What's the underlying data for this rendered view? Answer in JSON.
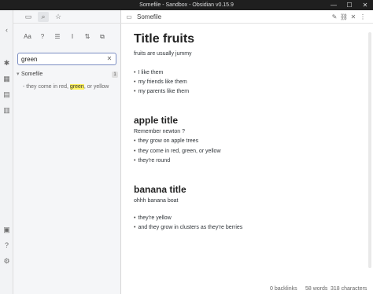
{
  "window": {
    "title": "Somefile - Sandbox - Obsidian v0.15.9",
    "minimize_glyph": "—",
    "maximize_glyph": "☐",
    "close_glyph": "✕"
  },
  "ribbon": {
    "icons": [
      "open-sidebar-icon",
      "graph-view-icon",
      "calendar-icon",
      "file-explorer-icon",
      "stack-icon",
      "vault-icon",
      "help-icon",
      "settings-icon"
    ]
  },
  "sidebar": {
    "tabs": [
      {
        "name": "file-explorer-tab",
        "glyph": "▭"
      },
      {
        "name": "search-tab",
        "glyph": "⌕"
      },
      {
        "name": "starred-tab",
        "glyph": "☆"
      }
    ],
    "search_tools": [
      {
        "name": "match-case-toggle",
        "glyph": "Aa"
      },
      {
        "name": "explain-search-toggle",
        "glyph": "?"
      },
      {
        "name": "collapse-results-toggle",
        "glyph": "☰"
      },
      {
        "name": "show-more-context-toggle",
        "glyph": "I"
      },
      {
        "name": "sort-order-button",
        "glyph": "⇅"
      },
      {
        "name": "copy-results-button",
        "glyph": "⧉"
      }
    ],
    "search": {
      "value": "green",
      "clear_glyph": "✕"
    },
    "results": [
      {
        "file": "Somefile",
        "count": "1",
        "match_before": "- they come in red, ",
        "match_highlight": "green",
        "match_after": ", or yellow"
      }
    ]
  },
  "editor": {
    "tab_title": "Somefile",
    "actions": [
      "edit-icon",
      "link-icon",
      "close-icon",
      "more-icon"
    ],
    "content": {
      "h1": "Title fruits",
      "p1": "fruits are usually jummy",
      "list1": [
        "I like them",
        "my  friends like them",
        "my parents like them"
      ],
      "h2_apple": "apple title",
      "p_apple": "Remember newton ?",
      "list_apple": [
        "they grow on apple trees",
        "they come in red, green, or yellow",
        "they're round"
      ],
      "h2_banana": "banana title",
      "p_banana": "ohhh banana boat",
      "list_banana": [
        "they're yellow",
        "and they grow in clusters as they're berries"
      ]
    }
  },
  "statusbar": {
    "backlinks": "0 backlinks",
    "words": "58 words",
    "characters": "318 characters"
  }
}
